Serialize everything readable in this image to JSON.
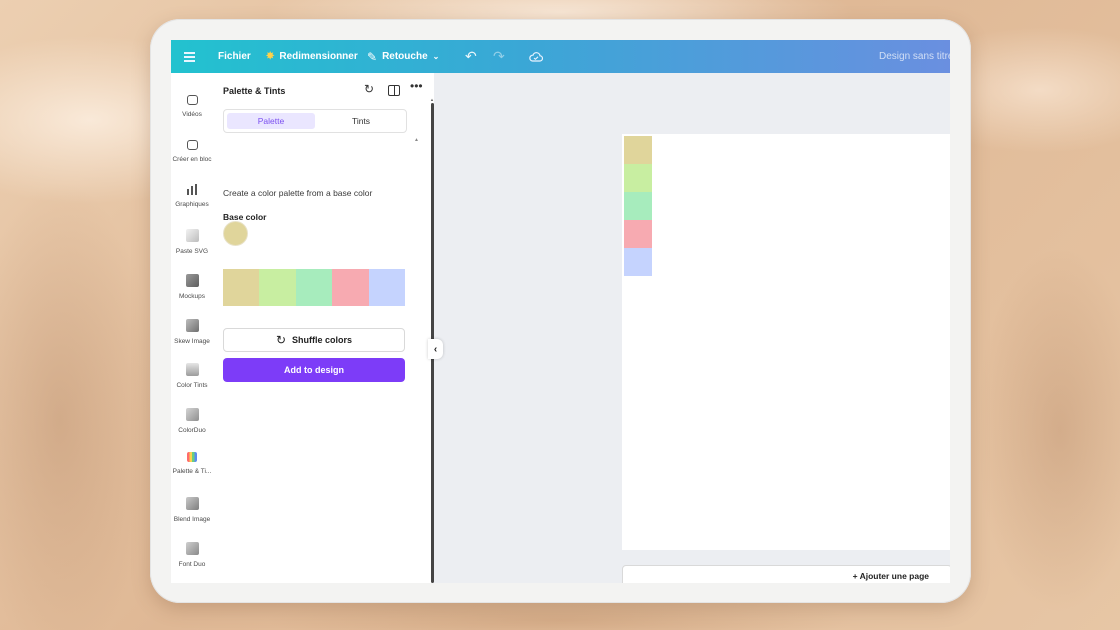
{
  "topbar": {
    "file": "Fichier",
    "resize": "Redimensionner",
    "retouch": "Retouche",
    "title": "Design sans titre"
  },
  "rail": {
    "items": [
      {
        "label": "Vidéos",
        "icon": "video-icon"
      },
      {
        "label": "Créer en bloc",
        "icon": "bulk-create-icon"
      },
      {
        "label": "Graphiques",
        "icon": "chart-icon"
      },
      {
        "label": "Paste SVG",
        "icon": "paste-svg-icon"
      },
      {
        "label": "Mockups",
        "icon": "mockups-icon"
      },
      {
        "label": "Skew Image",
        "icon": "skew-image-icon"
      },
      {
        "label": "Color Tints",
        "icon": "color-tints-icon"
      },
      {
        "label": "ColorDuo",
        "icon": "colorduo-icon"
      },
      {
        "label": "Palette & Ti...",
        "icon": "palette-tints-icon"
      },
      {
        "label": "Blend Image",
        "icon": "blend-image-icon"
      },
      {
        "label": "Font Duo",
        "icon": "font-duo-icon"
      }
    ]
  },
  "panel": {
    "title": "Palette & Tints",
    "tabs": [
      "Palette",
      "Tints"
    ],
    "active_tab": "Palette",
    "description": "Create a color palette from a base color",
    "base_label": "Base color",
    "base_color": "#e0d59b",
    "palette": [
      "#e0d59b",
      "#c8eea1",
      "#a7ecbd",
      "#f7aab1",
      "#c5d3fe"
    ],
    "shuffle_label": "Shuffle colors",
    "add_label": "Add to design"
  },
  "canvas": {
    "swatches": [
      "#e0d59b",
      "#c8eea1",
      "#a7ecbd",
      "#f7aab1",
      "#c5d3fe"
    ],
    "add_page": "+ Ajouter une page"
  },
  "colors": {
    "accent": "#7d3cf8",
    "topbar_start": "#22c2cf",
    "topbar_end": "#6a8fe0"
  }
}
